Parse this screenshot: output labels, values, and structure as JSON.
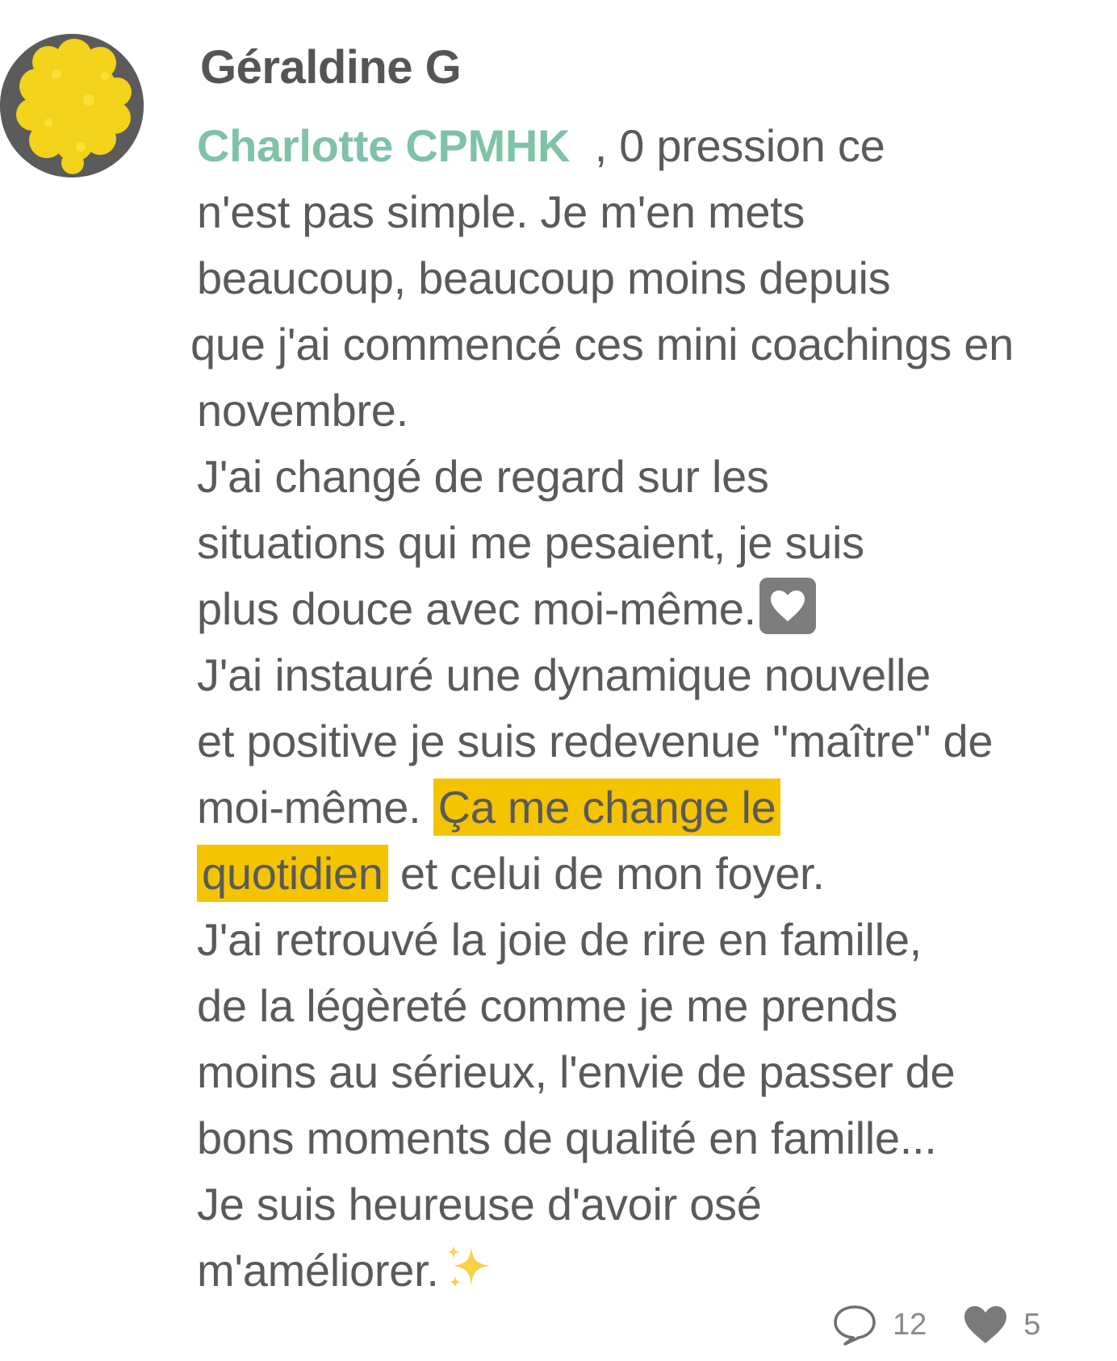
{
  "comment": {
    "author": "Géraldine G",
    "mention": "Charlotte CPMHK",
    "lines": [
      ", 0 pression ce",
      "n'est pas simple. Je m'en mets",
      "beaucoup, beaucoup moins depuis",
      "que j'ai commencé ces mini coachings en",
      "novembre.",
      "J'ai changé de regard sur les",
      "situations qui me pesaient, je suis",
      "plus douce avec moi-même.",
      "J'ai instauré une dynamique nouvelle",
      "et positive je suis redevenue \"maître\" de",
      "moi-même.",
      "Ça me change le",
      "quotidien",
      "et celui de mon foyer.",
      "J'ai retrouvé la joie de rire en famille,",
      "de la légèreté comme je me prends",
      "moins au sérieux, l'envie de passer de",
      "bons moments de qualité en famille...",
      "Je suis heureuse d'avoir osé",
      "m'améliorer."
    ],
    "emoji": {
      "heart": "white-heart-emoji",
      "sparkles": "sparkles-emoji"
    },
    "colors": {
      "mention": "#7fc2a8",
      "highlight": "#f5c400",
      "text": "#5a5a5a",
      "avatar_fill": "#f2d21a"
    }
  },
  "footer": {
    "comments_count": "12",
    "likes_count": "5",
    "comment_icon": "speech-bubble-icon",
    "like_icon": "heart-icon"
  }
}
